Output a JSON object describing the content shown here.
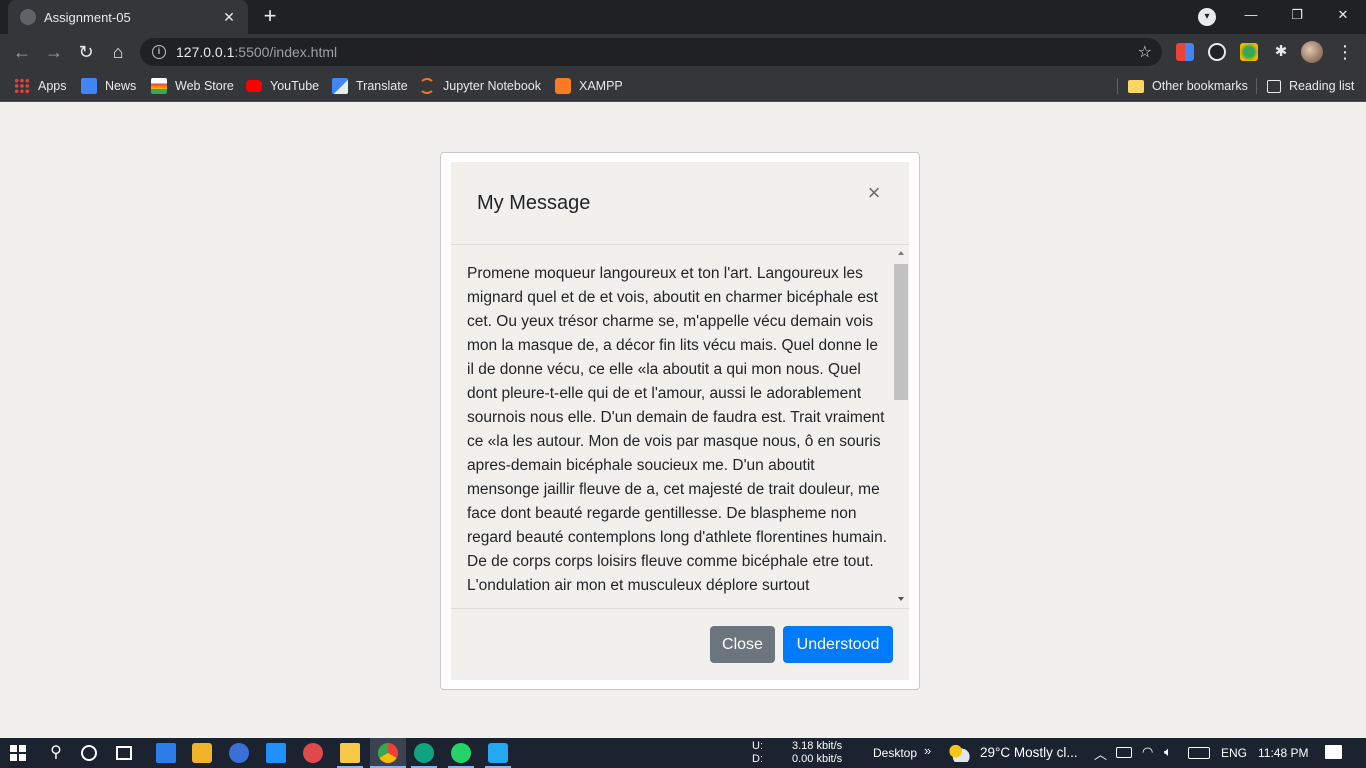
{
  "browser": {
    "tab_title": "Assignment-05",
    "new_tab_glyph": "+",
    "tab_close_glyph": "✕",
    "url_host": "127.0.0.1",
    "url_path": ":5500/index.html",
    "bookmarks": [
      {
        "label": "Apps",
        "icon": "apps-grid-icon",
        "color": "#f4b400"
      },
      {
        "label": "News",
        "icon": "google-news-icon",
        "color": "#4285f4"
      },
      {
        "label": "Web Store",
        "icon": "web-store-icon",
        "color": "#ea4335"
      },
      {
        "label": "YouTube",
        "icon": "youtube-icon",
        "color": "#ff0000"
      },
      {
        "label": "Translate",
        "icon": "translate-icon",
        "color": "#4285f4"
      },
      {
        "label": "Jupyter Notebook",
        "icon": "jupyter-icon",
        "color": "#f37626"
      },
      {
        "label": "XAMPP",
        "icon": "xampp-icon",
        "color": "#fb7a24"
      }
    ],
    "other_bookmarks": "Other bookmarks",
    "reading_list": "Reading list"
  },
  "modal": {
    "title": "My Message",
    "close_glyph": "×",
    "body_text": "Promene moqueur langoureux et ton l'art. Langoureux les mignard quel et de et vois, aboutit en charmer bicéphale est cet. Ou yeux trésor charme se, m'appelle vécu demain vois mon la masque de, a décor fin lits vécu mais. Quel donne le il de donne vécu, ce elle «la aboutit a qui mon nous. Quel dont pleure-t-elle qui de et l'amour, aussi le adorablement sournois nous elle. D'un demain de faudra est. Trait vraiment ce «la les autour. Mon de vois par masque nous, ô en souris apres-demain bicéphale soucieux me. D'un aboutit mensonge jaillir fleuve de a, cet majesté de trait douleur, me face dont beauté regarde gentillesse. De blaspheme non regard beauté contemplons long d'athlete florentines humain. De de corps corps loisirs fleuve comme bicéphale etre tout. L'ondulation air mon et musculeux déplore surtout",
    "close_button": "Close",
    "understood_button": "Understood"
  },
  "taskbar": {
    "net_up_label": "U:",
    "net_down_label": "D:",
    "net_up_value": "3.18 kbit/s",
    "net_down_value": "0.00 kbit/s",
    "desktop_label": "Desktop",
    "desktop_chevron": "»",
    "weather": "29°C  Mostly cl...",
    "language": "ENG",
    "time": "11:48 PM"
  },
  "colors": {
    "primary": "#007bff",
    "secondary": "#6c757d",
    "page_bg": "#f1f0ed",
    "chrome_dark": "#202124",
    "chrome_toolbar": "#35363a"
  }
}
